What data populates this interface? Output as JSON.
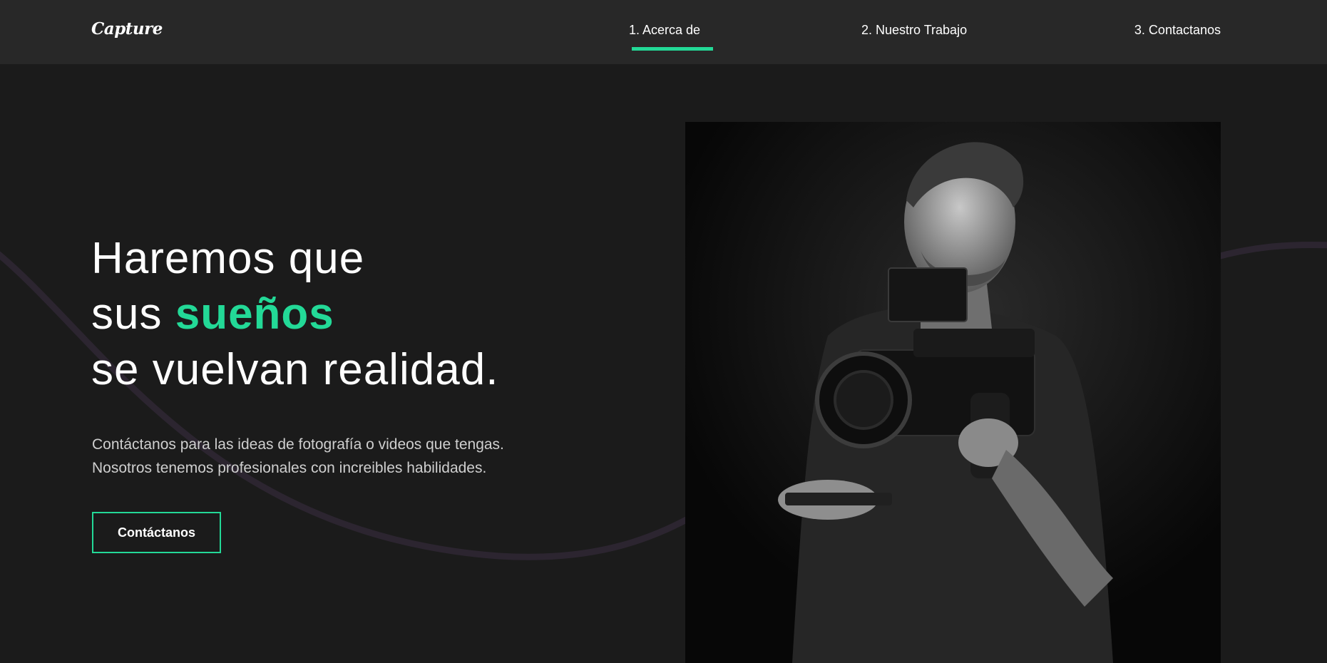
{
  "nav": {
    "logo": "Capture",
    "links": [
      {
        "label": "1. Acerca de",
        "active": true
      },
      {
        "label": "2. Nuestro Trabajo",
        "active": false
      },
      {
        "label": "3. Contactanos",
        "active": false
      }
    ]
  },
  "hero": {
    "title_line1": "Haremos que",
    "title_line2_prefix": "sus ",
    "title_line2_accent": "sueños",
    "title_line3": "se vuelvan realidad.",
    "description_line1": "Contáctanos para las ideas de fotografía o videos que tengas.",
    "description_line2": "Nosotros tenemos profesionales con increibles habilidades.",
    "button_label": "Contáctanos"
  },
  "colors": {
    "accent": "#23d997",
    "background": "#1b1b1b",
    "navbar": "#282828",
    "curve": "#2c2530"
  },
  "icons": {
    "hero_image": "videographer-with-camera-photo"
  }
}
